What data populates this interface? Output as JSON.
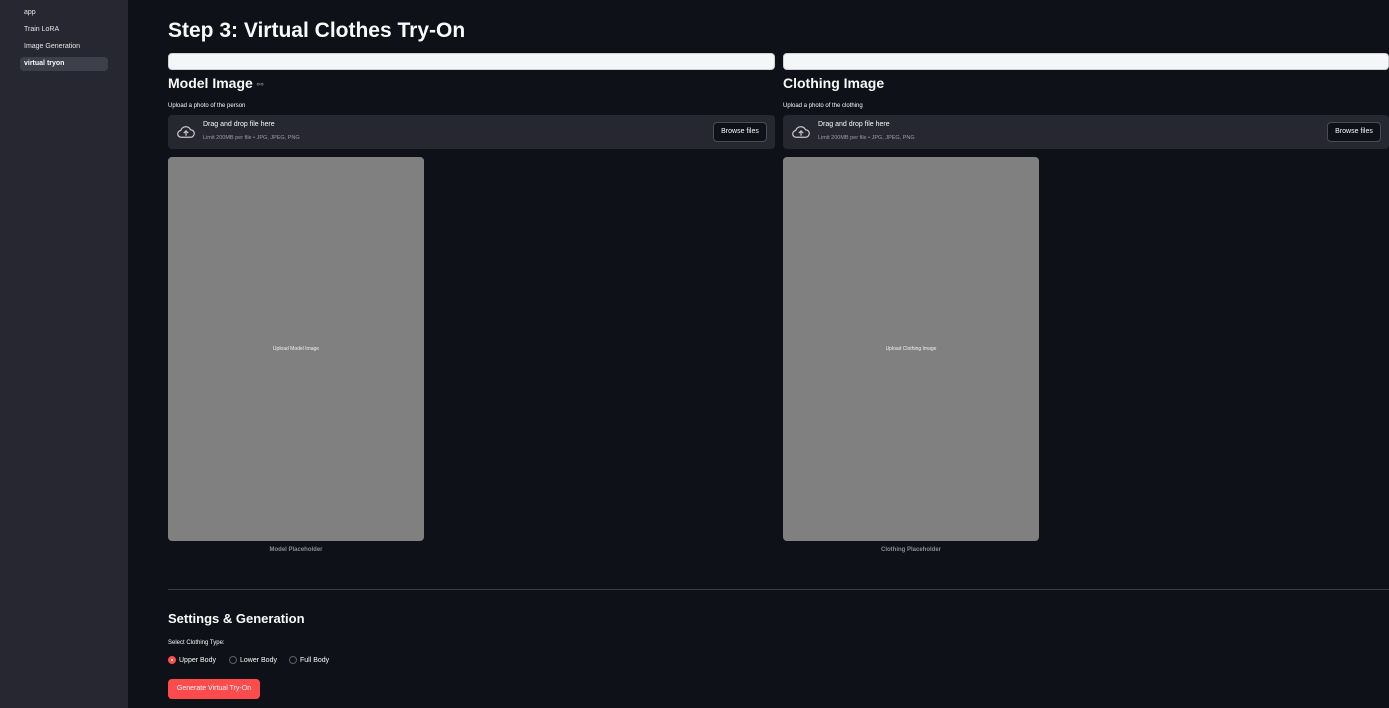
{
  "sidebar": {
    "items": [
      {
        "label": "app"
      },
      {
        "label": "Train LoRA"
      },
      {
        "label": "Image Generation"
      },
      {
        "label": "virtual tryon"
      }
    ]
  },
  "page_title": "Step 3: Virtual Clothes Try-On",
  "model": {
    "title": "Model Image",
    "upload_label": "Upload a photo of the person",
    "drop_text": "Drag and drop file here",
    "limit_text": "Limit 200MB per file • JPG, JPEG, PNG",
    "browse_label": "Browse files",
    "placeholder_text": "Upload Model Image",
    "caption": "Model Placeholder"
  },
  "clothing": {
    "title": "Clothing Image",
    "upload_label": "Upload a photo of the clothing",
    "drop_text": "Drag and drop file here",
    "limit_text": "Limit 200MB per file • JPG, JPEG, PNG",
    "browse_label": "Browse files",
    "placeholder_text": "Upload Clothing Image",
    "caption": "Clothing Placeholder"
  },
  "settings": {
    "title": "Settings & Generation",
    "clothing_type_label": "Select Clothing Type:",
    "options": [
      {
        "label": "Upper Body",
        "selected": true
      },
      {
        "label": "Lower Body",
        "selected": false
      },
      {
        "label": "Full Body",
        "selected": false
      }
    ],
    "generate_label": "Generate Virtual Try-On"
  },
  "colors": {
    "accent": "#ff4b4b",
    "background": "#0e1117",
    "sidebar": "#262730",
    "placeholder": "#808080"
  },
  "icons": {
    "link": "link-icon",
    "upload": "cloud-upload-icon"
  }
}
